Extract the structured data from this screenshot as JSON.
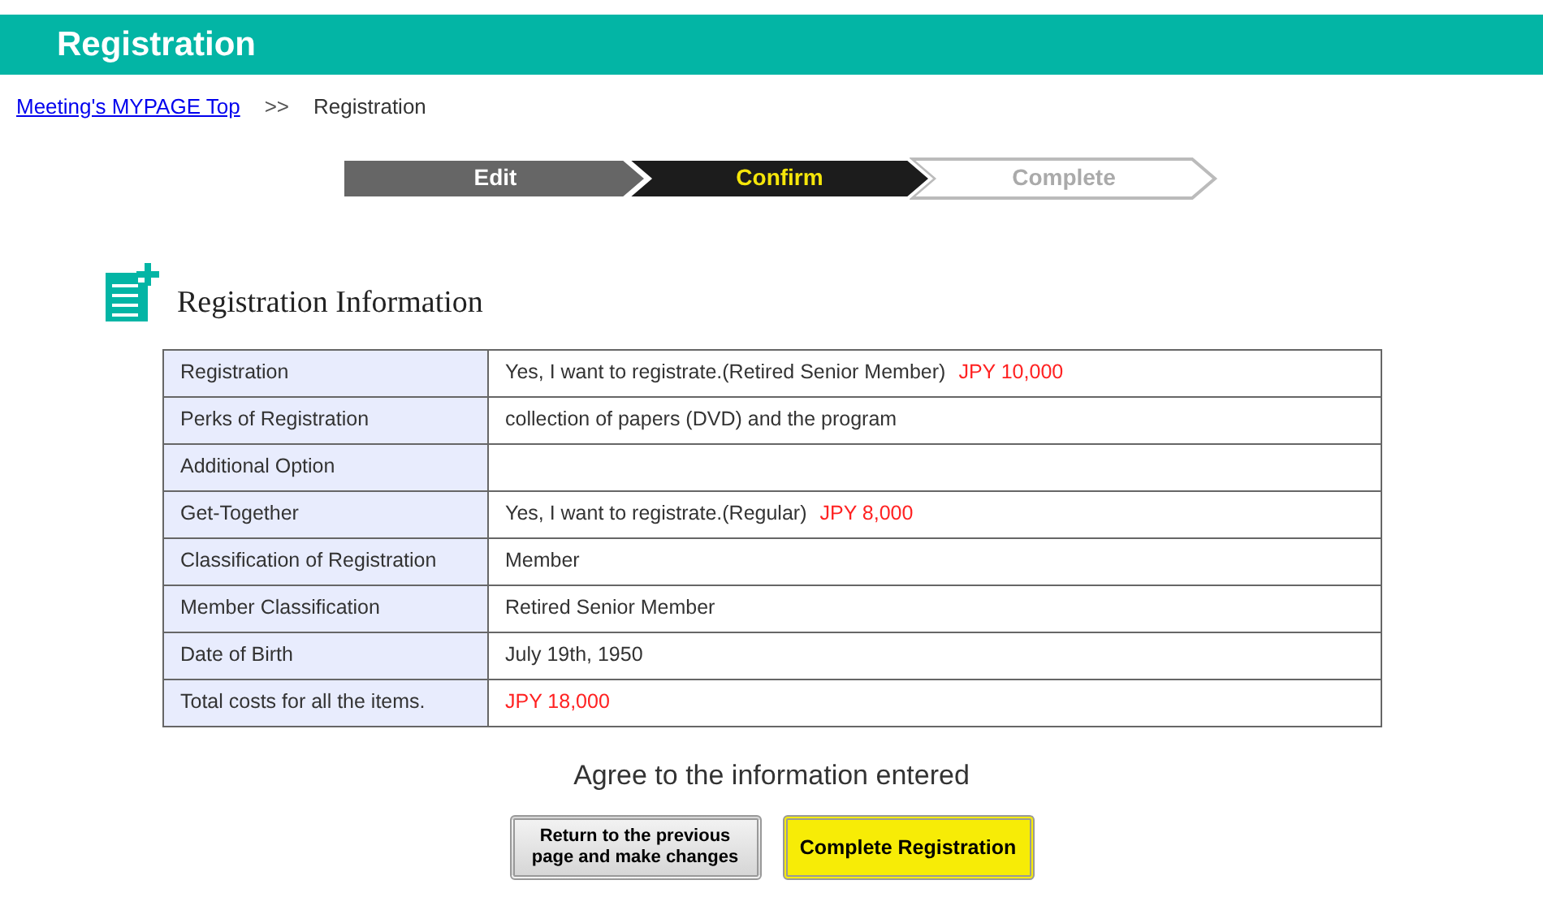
{
  "header": {
    "title": "Registration"
  },
  "breadcrumb": {
    "link": "Meeting's MYPAGE Top",
    "separator": ">>",
    "current": "Registration"
  },
  "steps": [
    {
      "label": "Edit",
      "kind": "done"
    },
    {
      "label": "Confirm",
      "kind": "current"
    },
    {
      "label": "Complete",
      "kind": "todo"
    }
  ],
  "section_title": "Registration Information",
  "table": {
    "rows": [
      {
        "label": "Registration",
        "value": "Yes, I want to registrate.(Retired Senior Member)",
        "price": "JPY 10,000"
      },
      {
        "label": "Perks of Registration",
        "value": "collection of papers (DVD) and the program"
      },
      {
        "label": "Additional Option"
      },
      {
        "label": "Get-Together",
        "value": "Yes, I want to registrate.(Regular)",
        "price": "JPY 8,000"
      },
      {
        "label": "Classification of Registration",
        "value": "Member"
      },
      {
        "label": "Member Classification",
        "value": "Retired Senior Member"
      },
      {
        "label": "Date of Birth",
        "value": "July 19th, 1950"
      },
      {
        "label": "Total costs for all the items.",
        "price": "JPY 18,000"
      }
    ]
  },
  "agree_text": "Agree to the information entered",
  "buttons": [
    {
      "label": "Return to the previous page and make changes",
      "kind": "secondary"
    },
    {
      "label": "Complete Registration",
      "kind": "primary"
    }
  ]
}
